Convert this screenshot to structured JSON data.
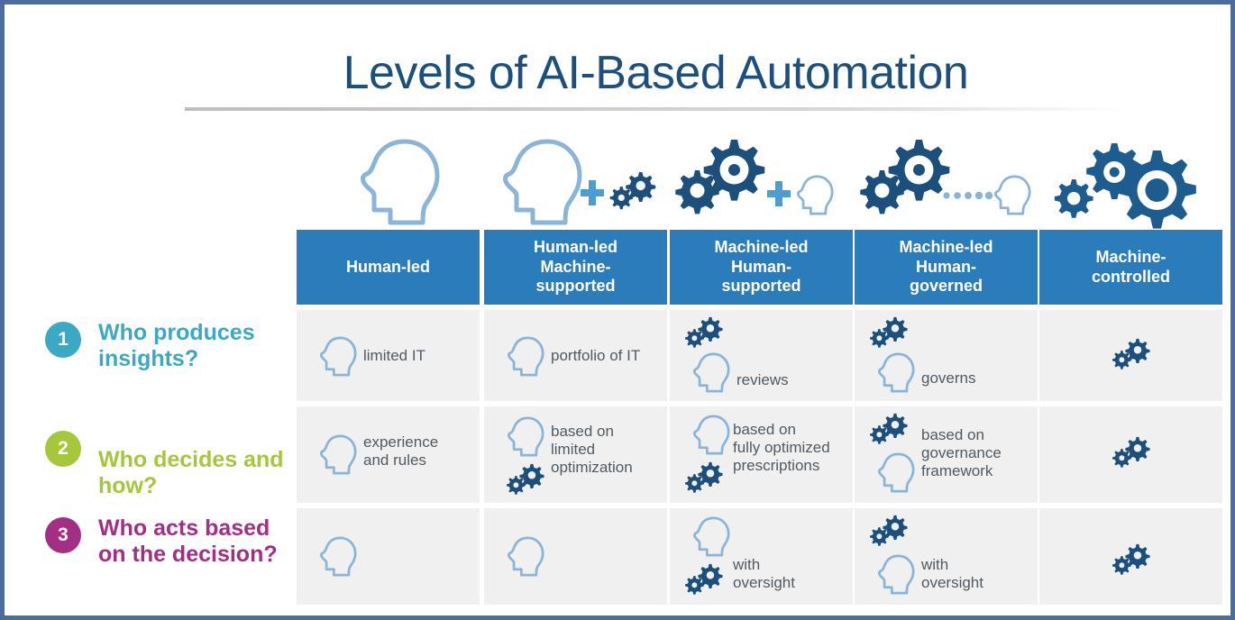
{
  "page_title": "Levels of AI-Based Automation",
  "colors": {
    "frame_border": "#4e6c9b",
    "title_text": "#1d4f7c",
    "header_fill": "#2b7cba",
    "cell_fill": "#f0f0f0",
    "cell_text": "#4f5a63",
    "head_icon_outline": "#8ab4d8",
    "gear_dark": "#1d4f7c",
    "gear_mid": "#1f5a87",
    "badge_1": "#3ba9c4",
    "badge_2": "#a6c63b",
    "badge_3": "#a32f85",
    "plus_blue": "#4f9cd0",
    "dotted_blue": "#8ab4d8"
  },
  "columns": [
    {
      "id": "human-led",
      "header": "Human-led",
      "top_icon": "head-icon",
      "top_icon_parts": [
        "head-large"
      ]
    },
    {
      "id": "human-led-machine-supported",
      "header": "Human-led\nMachine-\nsupported",
      "header_lines": [
        "Human-led",
        "Machine-",
        "supported"
      ],
      "top_icon": "head-plus-gears-icon",
      "top_icon_parts": [
        "head-large",
        "plus-sign",
        "gears-small"
      ]
    },
    {
      "id": "machine-led-human-supported",
      "header": "Machine-led\nHuman-\nsupported",
      "header_lines": [
        "Machine-led",
        "Human-",
        "supported"
      ],
      "top_icon": "gears-plus-head-icon",
      "top_icon_parts": [
        "gears-large",
        "plus-sign",
        "head-small"
      ]
    },
    {
      "id": "machine-led-human-governed",
      "header": "Machine-led\nHuman-\ngoverned",
      "header_lines": [
        "Machine-led",
        "Human-",
        "governed"
      ],
      "top_icon": "gears-dotted-head-icon",
      "top_icon_parts": [
        "gears-large",
        "dotted-line",
        "head-small"
      ]
    },
    {
      "id": "machine-controlled",
      "header": "Machine-\ncontrolled",
      "header_lines": [
        "Machine-",
        "controlled"
      ],
      "top_icon": "gears-triple-icon",
      "top_icon_parts": [
        "gears-triple"
      ]
    }
  ],
  "rows": [
    {
      "number": "1",
      "badge_color": "#3ba9c4",
      "question": "Who produces insights?",
      "cells": [
        {
          "text": "limited IT",
          "icons": [
            "head-icon"
          ],
          "layout": "head-left-text-right"
        },
        {
          "text": "portfolio of IT",
          "icons": [
            "head-icon"
          ],
          "layout": "head-left-text-right"
        },
        {
          "text": "reviews",
          "icons": [
            "gears-icon",
            "head-icon"
          ],
          "layout": "gears-top-head-left-text-right"
        },
        {
          "text": "governs",
          "icons": [
            "gears-icon",
            "head-icon"
          ],
          "layout": "gears-top-head-left-text-right"
        },
        {
          "text": "",
          "icons": [
            "gears-icon"
          ],
          "layout": "gears-center"
        }
      ]
    },
    {
      "number": "2",
      "badge_color": "#a6c63b",
      "question": "Who decides and how?",
      "cells": [
        {
          "text": "experience\nand rules",
          "lines": [
            "experience",
            "and rules"
          ],
          "icons": [
            "head-icon"
          ],
          "layout": "head-left-text-right"
        },
        {
          "text": "based on\nlimited\noptimization",
          "lines": [
            "based on",
            "limited",
            "optimization"
          ],
          "icons": [
            "head-icon",
            "gears-icon"
          ],
          "layout": "head-top-gears-bottom-text-right"
        },
        {
          "text": "based on\nfully optimized\nprescriptions",
          "lines": [
            "based on",
            "fully optimized",
            "prescriptions"
          ],
          "icons": [
            "head-icon",
            "gears-icon"
          ],
          "layout": "head-top-gears-bottom-text-right"
        },
        {
          "text": "based on\ngovernance\nframework",
          "lines": [
            "based on",
            "governance",
            "framework"
          ],
          "icons": [
            "gears-icon",
            "head-icon"
          ],
          "layout": "gears-top-head-bottom-text-right"
        },
        {
          "text": "",
          "icons": [
            "gears-icon"
          ],
          "layout": "gears-center"
        }
      ]
    },
    {
      "number": "3",
      "badge_color": "#a32f85",
      "question": "Who acts based on the decision?",
      "cells": [
        {
          "text": "",
          "icons": [
            "head-icon"
          ],
          "layout": "head-only"
        },
        {
          "text": "",
          "icons": [
            "head-icon"
          ],
          "layout": "head-only"
        },
        {
          "text": "with\noversight",
          "lines": [
            "with",
            "oversight"
          ],
          "icons": [
            "head-icon",
            "gears-icon"
          ],
          "layout": "head-top-gears-bottom-text-right"
        },
        {
          "text": "with\noversight",
          "lines": [
            "with",
            "oversight"
          ],
          "icons": [
            "gears-icon",
            "head-icon"
          ],
          "layout": "gears-top-head-bottom-text-right"
        },
        {
          "text": "",
          "icons": [
            "gears-icon"
          ],
          "layout": "gears-center"
        }
      ]
    }
  ]
}
